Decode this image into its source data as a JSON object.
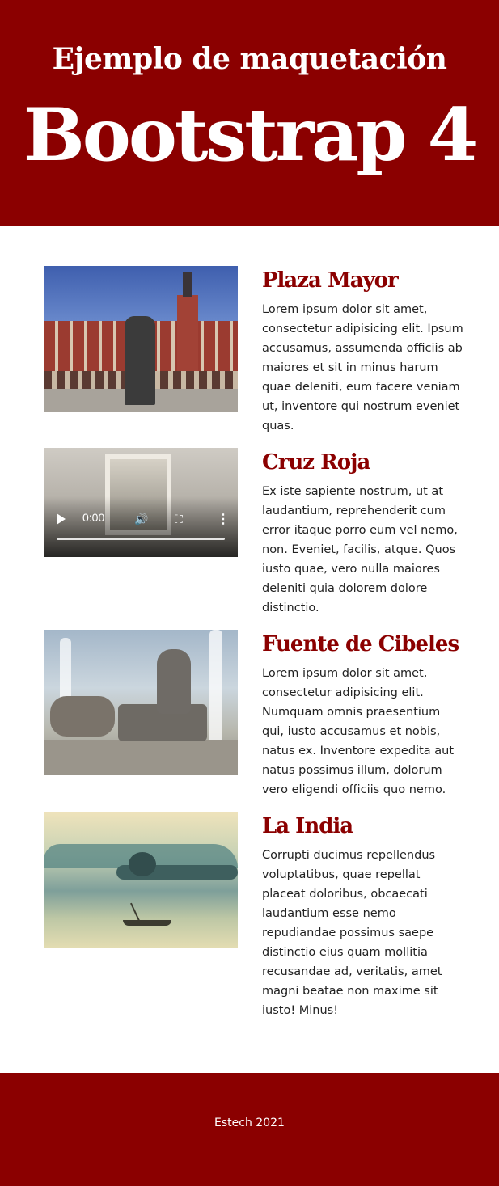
{
  "header": {
    "subtitle": "Ejemplo de maquetación",
    "title": "Bootstrap 4",
    "background_color": "#8b0000"
  },
  "sections": [
    {
      "title": "Plaza Mayor",
      "media": "image",
      "text": "Lorem ipsum dolor sit amet, consectetur adipisicing elit. Ipsum accusamus, assumenda officiis ab maiores et sit in minus harum quae deleniti, eum facere veniam ut, inventore qui nostrum eveniet quas."
    },
    {
      "title": "Cruz Roja",
      "media": "video",
      "video_time": "0:00",
      "text": "Ex iste sapiente nostrum, ut at laudantium, reprehenderit cum error itaque porro eum vel nemo, non. Eveniet, facilis, atque. Quos iusto quae, vero nulla maiores deleniti quia dolorem dolore distinctio."
    },
    {
      "title": "Fuente de Cibeles",
      "media": "image",
      "text": "Lorem ipsum dolor sit amet, consectetur adipisicing elit. Numquam omnis praesentium qui, iusto accusamus et nobis, natus ex. Inventore expedita aut natus possimus illum, dolorum vero eligendi officiis quo nemo."
    },
    {
      "title": "La India",
      "media": "image",
      "text": "Corrupti ducimus repellendus voluptatibus, quae repellat placeat doloribus, obcaecati laudantium esse nemo repudiandae possimus saepe distinctio eius quam mollitia recusandae ad, veritatis, amet magni beatae non maxime sit iusto! Minus!"
    }
  ],
  "footer": {
    "text": "Estech 2021"
  },
  "colors": {
    "accent": "#8b0000",
    "body_text": "#222222"
  }
}
